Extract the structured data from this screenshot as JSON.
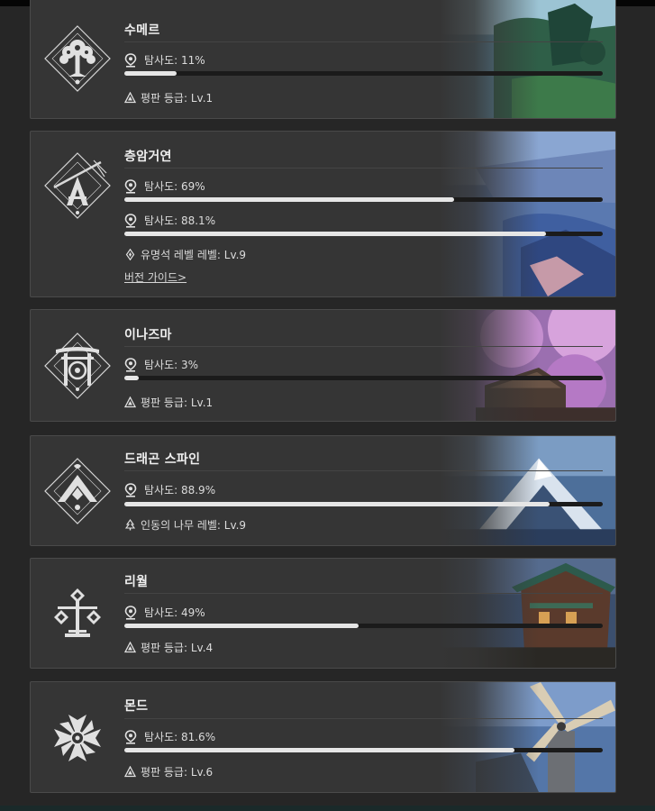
{
  "regions": [
    {
      "name": "수메르",
      "emblem_icon": "sumeru-emblem-icon",
      "exploration": [
        {
          "label": "탐사도: 11%",
          "progress": 0.11
        }
      ],
      "extra": {
        "icon": "reputation-icon",
        "text": "평판 등급: Lv.1"
      }
    },
    {
      "name": "층암거연",
      "emblem_icon": "chasm-emblem-icon",
      "exploration": [
        {
          "label": "탐사도: 69%",
          "progress": 0.69
        },
        {
          "label": "탐사도: 88.1%",
          "progress": 0.881
        }
      ],
      "extra": {
        "icon": "lumenstone-icon",
        "text": "유명석 레벨 레벨: Lv.9"
      },
      "link": "버전 가이드>"
    },
    {
      "name": "이나즈마",
      "emblem_icon": "inazuma-emblem-icon",
      "exploration": [
        {
          "label": "탐사도: 3%",
          "progress": 0.03
        }
      ],
      "extra": {
        "icon": "reputation-icon",
        "text": "평판 등급: Lv.1"
      }
    },
    {
      "name": "드래곤 스파인",
      "emblem_icon": "dragonspine-emblem-icon",
      "exploration": [
        {
          "label": "탐사도: 88.9%",
          "progress": 0.889
        }
      ],
      "extra": {
        "icon": "frostbearing-tree-icon",
        "text": "인동의 나무 레벨: Lv.9"
      }
    },
    {
      "name": "리월",
      "emblem_icon": "liyue-emblem-icon",
      "exploration": [
        {
          "label": "탐사도: 49%",
          "progress": 0.49
        }
      ],
      "extra": {
        "icon": "reputation-icon",
        "text": "평판 등급: Lv.4"
      }
    },
    {
      "name": "몬드",
      "emblem_icon": "mondstadt-emblem-icon",
      "exploration": [
        {
          "label": "탐사도: 81.6%",
          "progress": 0.816
        }
      ],
      "extra": {
        "icon": "reputation-icon",
        "text": "평판 등급: Lv.6"
      }
    }
  ],
  "colors": {
    "background": "#262626",
    "card": "#353535",
    "bar_fill": "#e6e6e6",
    "bar_track": "#1b1b1b"
  }
}
